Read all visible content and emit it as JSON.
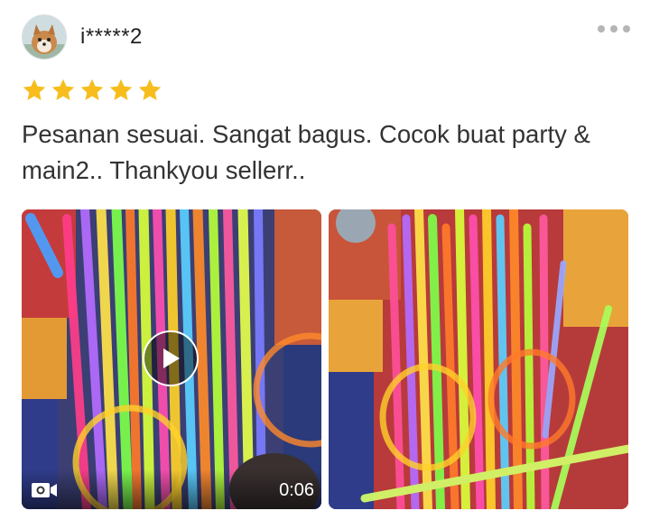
{
  "reviewer": {
    "username": "i*****2",
    "avatar": "avatar-dog-photo"
  },
  "rating": {
    "value": 5,
    "max": 5,
    "star_color": "#f6bd1c"
  },
  "review_text": "Pesanan sesuai. Sangat bagus. Cocok buat party & main2.. Thankyou sellerr..",
  "menu": {
    "icon": "more-dots-icon"
  },
  "media": {
    "video": {
      "duration": "0:06",
      "play_icon": "play-icon",
      "type_icon": "video-camera-icon"
    },
    "photo": {
      "type": "image"
    }
  }
}
